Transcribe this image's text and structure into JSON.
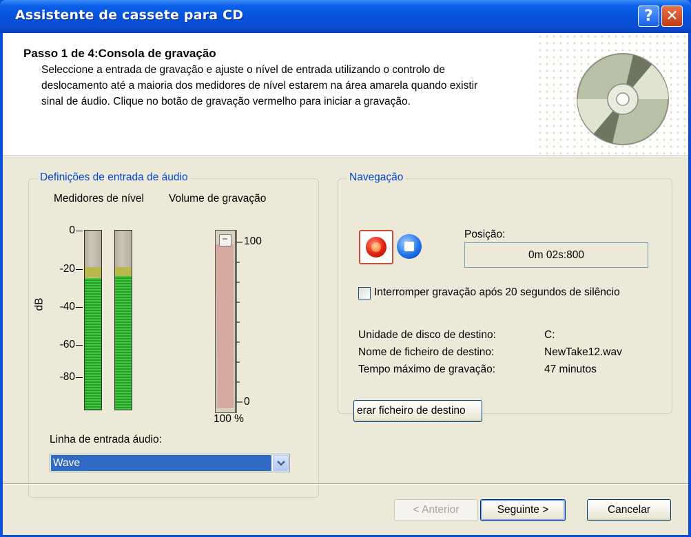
{
  "window": {
    "title": "Assistente de cassete para CD",
    "help_glyph": "?",
    "close_glyph": "✕"
  },
  "header": {
    "step_title": "Passo 1 de 4:Consola de gravação",
    "description": "Seleccione a entrada de gravação e ajuste o nível de entrada utilizando o controlo de deslocamento até a maioria dos medidores de nível estarem na área amarela quando existir sinal de áudio. Clique no botão de gravação vermelho para iniciar a gravação.",
    "icon": "cd-disc-icon"
  },
  "audio_input": {
    "group_label": "Definições de entrada de áudio",
    "meters_label": "Medidores de nível",
    "volume_label": "Volume de gravação",
    "db_axis_label": "dB",
    "db_ticks": [
      "0",
      "-20",
      "-40",
      "-60",
      "-80"
    ],
    "meter_left_level_db": -26,
    "meter_right_level_db": -25,
    "yellow_zone_db": [
      -20,
      -26
    ],
    "volume_ticks": [
      "100",
      "0"
    ],
    "volume_value": "100 %",
    "volume_percent": 100,
    "line_label": "Linha de entrada áudio:",
    "line_selected": "Wave"
  },
  "navigation": {
    "group_label": "Navegação",
    "record_icon": "record-icon",
    "stop_icon": "stop-icon",
    "position_label": "Posição:",
    "position_value": "0m 02s:800",
    "stop_on_silence_label": "Interromper gravação após 20 segundos de silêncio",
    "stop_on_silence_checked": false,
    "dest_drive_label": "Unidade de disco de destino:",
    "dest_drive_value": "C:",
    "dest_file_label": "Nome de ficheiro de destino:",
    "dest_file_value": "NewTake12.wav",
    "max_time_label": "Tempo máximo de gravação:",
    "max_time_value": "47 minutos",
    "change_dest_button": "erar ficheiro de destino"
  },
  "footer": {
    "back_button": "< Anterior",
    "next_button": "Seguinte >",
    "cancel_button": "Cancelar"
  }
}
